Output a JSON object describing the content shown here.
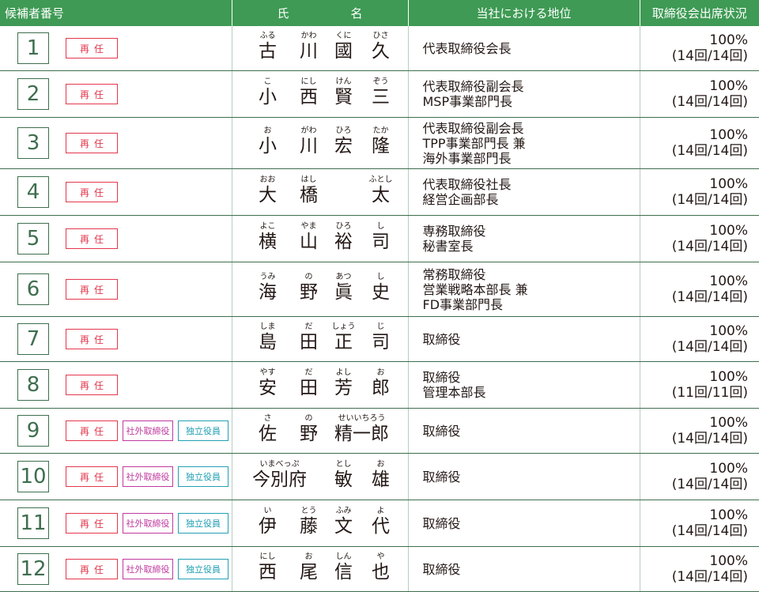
{
  "header": {
    "candidate_no": "候補者番号",
    "name_left": "氏",
    "name_right": "名",
    "position": "当社における地位",
    "attendance": "取締役会出席状況"
  },
  "badges": {
    "reappoint": "再任",
    "outside": "社外取締役",
    "independent": "独立役員"
  },
  "rows": [
    {
      "no": "1",
      "outside": false,
      "names": [
        [
          "ふる",
          "古"
        ],
        [
          "かわ",
          "川"
        ],
        [
          "くに",
          "國"
        ],
        [
          "ひさ",
          "久"
        ]
      ],
      "pos": [
        "代表取締役会長"
      ],
      "att_pct": "100%",
      "att_cnt": "(14回/14回)"
    },
    {
      "no": "2",
      "outside": false,
      "names": [
        [
          "こ",
          "小"
        ],
        [
          "にし",
          "西"
        ],
        [
          "けん",
          "賢"
        ],
        [
          "ぞう",
          "三"
        ]
      ],
      "pos": [
        "代表取締役副会長",
        "MSP事業部門長"
      ],
      "att_pct": "100%",
      "att_cnt": "(14回/14回)"
    },
    {
      "no": "3",
      "outside": false,
      "names": [
        [
          "お",
          "小"
        ],
        [
          "がわ",
          "川"
        ],
        [
          "ひろ",
          "宏"
        ],
        [
          "たか",
          "隆"
        ]
      ],
      "pos": [
        "代表取締役副会長",
        "TPP事業部門長 兼",
        "海外事業部門長"
      ],
      "att_pct": "100%",
      "att_cnt": "(14回/14回)"
    },
    {
      "no": "4",
      "outside": false,
      "names": [
        [
          "おお",
          "大"
        ],
        [
          "はし",
          "橋"
        ],
        [
          "",
          ""
        ],
        [
          "ふとし",
          "太"
        ]
      ],
      "pos": [
        "代表取締役社長",
        "経営企画部長"
      ],
      "att_pct": "100%",
      "att_cnt": "(14回/14回)"
    },
    {
      "no": "5",
      "outside": false,
      "names": [
        [
          "よこ",
          "横"
        ],
        [
          "やま",
          "山"
        ],
        [
          "ひろ",
          "裕"
        ],
        [
          "し",
          "司"
        ]
      ],
      "pos": [
        "専務取締役",
        "秘書室長"
      ],
      "att_pct": "100%",
      "att_cnt": "(14回/14回)"
    },
    {
      "no": "6",
      "outside": false,
      "names": [
        [
          "うみ",
          "海"
        ],
        [
          "の",
          "野"
        ],
        [
          "あつ",
          "眞"
        ],
        [
          "し",
          "史"
        ]
      ],
      "pos": [
        "常務取締役",
        "営業戦略本部長 兼",
        "FD事業部門長"
      ],
      "att_pct": "100%",
      "att_cnt": "(14回/14回)"
    },
    {
      "no": "7",
      "outside": false,
      "names": [
        [
          "しま",
          "島"
        ],
        [
          "だ",
          "田"
        ],
        [
          "しょう",
          "正"
        ],
        [
          "じ",
          "司"
        ]
      ],
      "pos": [
        "取締役"
      ],
      "att_pct": "100%",
      "att_cnt": "(14回/14回)"
    },
    {
      "no": "8",
      "outside": false,
      "names": [
        [
          "やす",
          "安"
        ],
        [
          "だ",
          "田"
        ],
        [
          "よし",
          "芳"
        ],
        [
          "お",
          "郎"
        ]
      ],
      "pos": [
        "取締役",
        "管理本部長"
      ],
      "att_pct": "100%",
      "att_cnt": "(11回/11回)"
    },
    {
      "no": "9",
      "outside": true,
      "names": [
        [
          "さ",
          "佐"
        ],
        [
          "の",
          "野"
        ],
        [
          "せいいちろう",
          "精一郎"
        ]
      ],
      "pos": [
        "取締役"
      ],
      "att_pct": "100%",
      "att_cnt": "(14回/14回)"
    },
    {
      "no": "10",
      "outside": true,
      "names": [
        [
          "いまべっぷ",
          "今別府"
        ],
        [
          "とし",
          "敏"
        ],
        [
          "お",
          "雄"
        ]
      ],
      "pos": [
        "取締役"
      ],
      "att_pct": "100%",
      "att_cnt": "(14回/14回)"
    },
    {
      "no": "11",
      "outside": true,
      "names": [
        [
          "い",
          "伊"
        ],
        [
          "とう",
          "藤"
        ],
        [
          "ふみ",
          "文"
        ],
        [
          "よ",
          "代"
        ]
      ],
      "pos": [
        "取締役"
      ],
      "att_pct": "100%",
      "att_cnt": "(14回/14回)"
    },
    {
      "no": "12",
      "outside": true,
      "names": [
        [
          "にし",
          "西"
        ],
        [
          "お",
          "尾"
        ],
        [
          "しん",
          "信"
        ],
        [
          "や",
          "也"
        ]
      ],
      "pos": [
        "取締役"
      ],
      "att_pct": "100%",
      "att_cnt": "(14回/14回)"
    }
  ]
}
